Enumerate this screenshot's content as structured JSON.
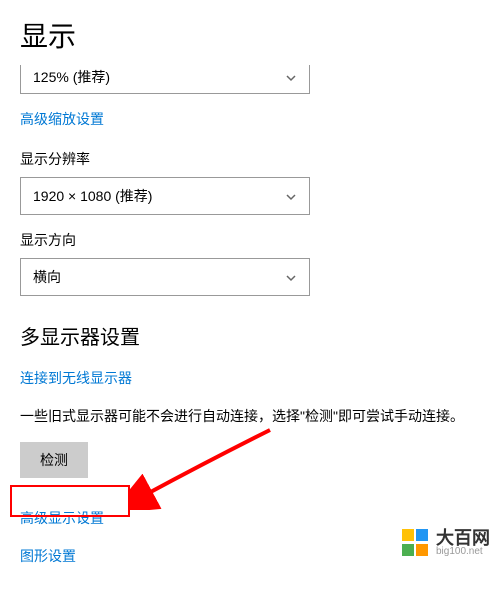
{
  "page_title": "显示",
  "scale": {
    "value": "125% (推荐)"
  },
  "advanced_scaling_link": "高级缩放设置",
  "resolution": {
    "label": "显示分辨率",
    "value": "1920 × 1080 (推荐)"
  },
  "orientation": {
    "label": "显示方向",
    "value": "横向"
  },
  "multi_display": {
    "title": "多显示器设置",
    "connect_wireless_link": "连接到无线显示器",
    "description": "一些旧式显示器可能不会进行自动连接，选择\"检测\"即可尝试手动连接。",
    "detect_button": "检测"
  },
  "advanced_display_link": "高级显示设置",
  "graphics_settings_link": "图形设置",
  "watermark": {
    "title": "大百网",
    "url": "big100.net"
  }
}
